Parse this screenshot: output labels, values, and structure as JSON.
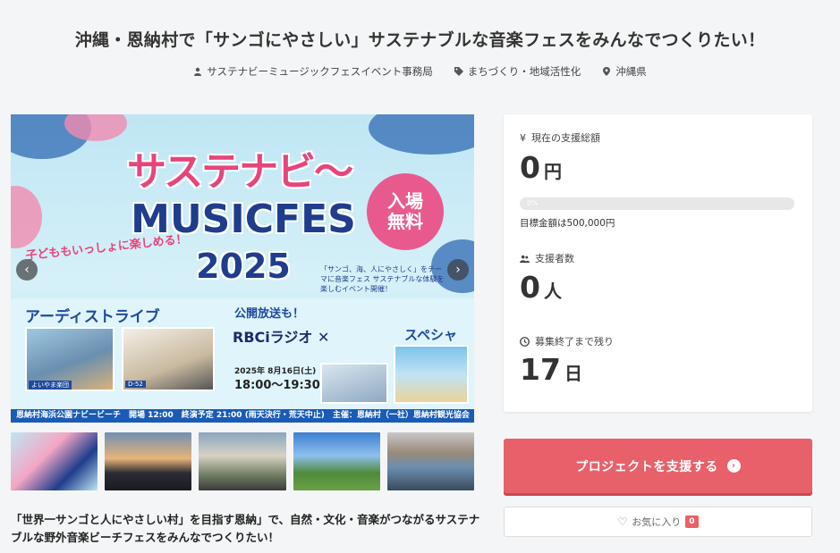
{
  "project": {
    "title": "沖縄・恩納村で「サンゴにやさしい」サステナブルな音楽フェスをみんなでつくりたい！",
    "organizer": "サステナビーミュージックフェスイベント事務局",
    "category": "まちづくり・地域活性化",
    "location": "沖縄県",
    "lead": "「世界一サンゴと人にやさしい村」を目指す恩納」で、自然・文化・音楽がつながるサステナブルな野外音楽ビーチフェスをみんなでつくりたい！"
  },
  "hero": {
    "logo_line1": "サステナビ〜",
    "logo_line2": "MUSICFES",
    "logo_line3": "2025",
    "badge_line1": "入場",
    "badge_line2": "無料",
    "kids_text": "子どももいっしょに楽しめる！",
    "desc_text": "「サンゴ、海、人にやさしく」をテーマに音楽フェス サステナブルな体験を楽しむイベント開催！",
    "artist_title": "アーディストライブ",
    "artist1_caption": "よいやま楽団",
    "artist2_caption": "D-52",
    "live_text": "公開放送も！",
    "radio_text": "RBCiラジオ ✕",
    "special_text": "スペシャル！",
    "date_text": "2025年 8月16日(土)",
    "time_text": "18:00〜19:30",
    "footer_text": "恩納村海浜公園ナビービーチ　開場 12:00　終演予定 21:00 (雨天決行・荒天中止)　主催：恩納村（一社）恩納村観光協会"
  },
  "stats": {
    "total_label": "現在の支援総額",
    "total_value": "0",
    "total_unit": "円",
    "progress_percent": 0,
    "progress_label": "0%",
    "goal_text": "目標金額は500,000円",
    "supporters_label": "支援者数",
    "supporters_value": "0",
    "supporters_unit": "人",
    "remaining_label": "募集終了まで残り",
    "remaining_value": "17",
    "remaining_unit": "日"
  },
  "actions": {
    "support_label": "プロジェクトを支援する",
    "favorite_label": "お気に入り",
    "favorite_count": "0"
  },
  "colors": {
    "accent": "#e8616a",
    "hero_navy": "#1f3d8c",
    "hero_pink": "#e6457c"
  }
}
